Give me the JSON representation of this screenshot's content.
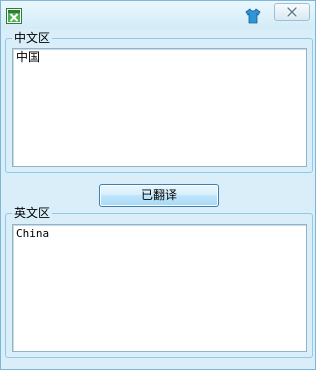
{
  "title_bar": {
    "app_icon": "excel-icon",
    "skin_icon": "shirt-icon",
    "close_icon": "close-x-icon"
  },
  "chinese_section": {
    "legend": "中文区",
    "text_value": "中国"
  },
  "action": {
    "translate_button_label": "已翻译"
  },
  "english_section": {
    "legend": "英文区",
    "text_value": "China"
  },
  "colors": {
    "window_background": "#d9eef9",
    "group_border": "#93c8e6",
    "button_border": "#3c7fb1",
    "textbox_background": "#ffffff"
  }
}
